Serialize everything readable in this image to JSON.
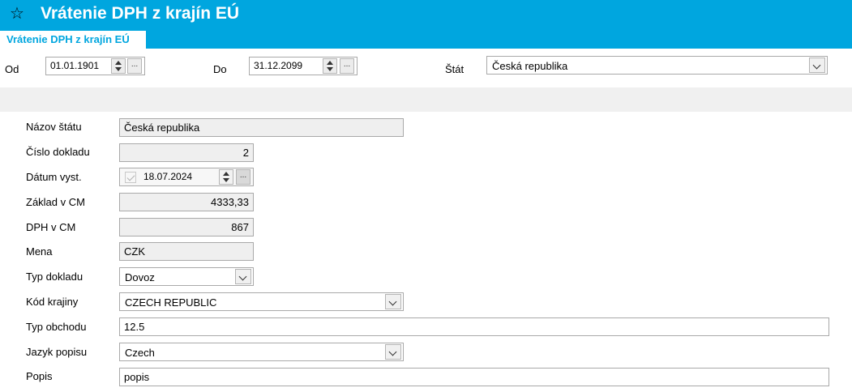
{
  "header": {
    "title": "Vrátenie DPH z krajín EÚ",
    "icon": "star-icon"
  },
  "tab": {
    "label": "Vrátenie DPH z krajín EÚ"
  },
  "filter": {
    "from_label": "Od",
    "from_value": "01.01.1901",
    "to_label": "Do",
    "to_value": "31.12.2099",
    "country_label": "Štát",
    "country_value": "Česká republika",
    "dots": "..."
  },
  "form": {
    "country_name_label": "Názov štátu",
    "country_name": "Česká republika",
    "doc_number_label": "Číslo dokladu",
    "doc_number": "2",
    "issue_date_label": "Dátum vyst.",
    "issue_date": "18.07.2024",
    "base_label": "Základ v CM",
    "base": "4333,33",
    "vat_label": "DPH v CM",
    "vat": "867",
    "currency_label": "Mena",
    "currency": "CZK",
    "doc_type_label": "Typ dokladu",
    "doc_type": "Dovoz",
    "country_code_label": "Kód krajiny",
    "country_code": "CZECH REPUBLIC",
    "trade_type_label": "Typ obchodu",
    "trade_type": "12.5",
    "lang_label": "Jazyk popisu",
    "lang": "Czech",
    "desc_label": "Popis",
    "desc": "popis"
  },
  "colors": {
    "accent": "#00a6df",
    "readonly_bg": "#efefef"
  }
}
